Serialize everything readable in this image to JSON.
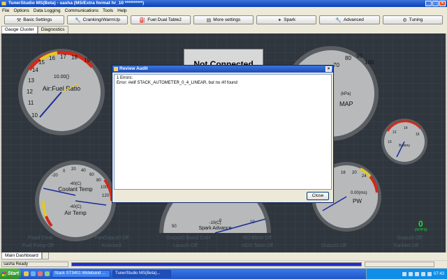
{
  "window": {
    "title": "TunerStudio MS(Beta) - sasha (MS/Extra format hr_10 **********)"
  },
  "menu": [
    "File",
    "Options",
    "Data Logging",
    "Communications",
    "Tools",
    "Help"
  ],
  "toolbar": [
    {
      "label": "Basic Settings",
      "icon": "tool-icon"
    },
    {
      "label": "Cranking/WarmUp",
      "icon": "wrench-icon"
    },
    {
      "label": "Fuel Dual Table2",
      "icon": "fuel-icon"
    },
    {
      "label": "More settings",
      "icon": "settings-icon"
    },
    {
      "label": "Spark",
      "icon": "spark-icon"
    },
    {
      "label": "Advanced",
      "icon": "wrench-icon"
    },
    {
      "label": "Tuning",
      "icon": "tuning-icon"
    }
  ],
  "tabs": [
    "Gauge Cluster",
    "Diagnostics"
  ],
  "dashboard": {
    "not_connected": "Not Connected",
    "afr_gauge": {
      "label": "Air:Fuel Ratio",
      "ticks": [
        "10",
        "11",
        "12",
        "13",
        "14",
        "15",
        "16",
        "17",
        "18",
        "19"
      ],
      "value": 10.0,
      "value_text": "10.00()"
    },
    "map_gauge": {
      "label": "MAP",
      "unit": "(kPa)",
      "ticks": [
        "60",
        "70",
        "80",
        "90",
        "100"
      ]
    },
    "battery_gauge": {
      "label": "Battery",
      "ticks": [
        "10",
        "12",
        "14",
        "16"
      ]
    },
    "temp_gauge": {
      "label_top": "Coolant Temp",
      "label_bottom": "Air Temp",
      "value_top": "-40(C)",
      "value_bottom": "-40(C)",
      "ticks": [
        "-20",
        "0",
        "20",
        "40",
        "60",
        "80",
        "100",
        "120"
      ]
    },
    "pw_gauge": {
      "label": "PW",
      "value": "0.00(ms)",
      "ticks": [
        "16",
        "20",
        "24"
      ]
    },
    "spark_gauge": {
      "label": "Spark Advance",
      "value": "-10(C)",
      "ticks": [
        "50",
        "0",
        "10"
      ]
    },
    "rpm_readout": {
      "value": "0",
      "unit": "(%TPS)"
    },
    "indicators": [
      "Flood Clear",
      "Fuel Pump Off",
      "FanOutput0 Off",
      "Knocked",
      "OutputO Boost Cntrl",
      "Launch Off",
      "RO/BMW Off",
      "NOS Table Off",
      "Output3 Off",
      "Output3 Off",
      "FanMet Off"
    ]
  },
  "dialog": {
    "title": "Review Audit",
    "lines": [
      "1 Errors:",
      "Error: #elif STACK_AUTOMETER_0_4_LINEAR, but no #if found"
    ],
    "close_label": "Close"
  },
  "bottom_tabs": [
    "Main Dashboard"
  ],
  "status": {
    "text": "sasha Ready",
    "progress": 1.0
  },
  "taskbar": {
    "start_label": "Start",
    "tasks": [
      "Stack ST3401 Wideband ...",
      "TunerStudio MS(Beta)..."
    ],
    "clock": "07:43"
  },
  "colors": {
    "dash_bg": "#30363d",
    "needle": "#1a2a9a",
    "redline": "#d02a1a",
    "yellowline": "#e0c82a",
    "digital": "#1fdc3c"
  }
}
